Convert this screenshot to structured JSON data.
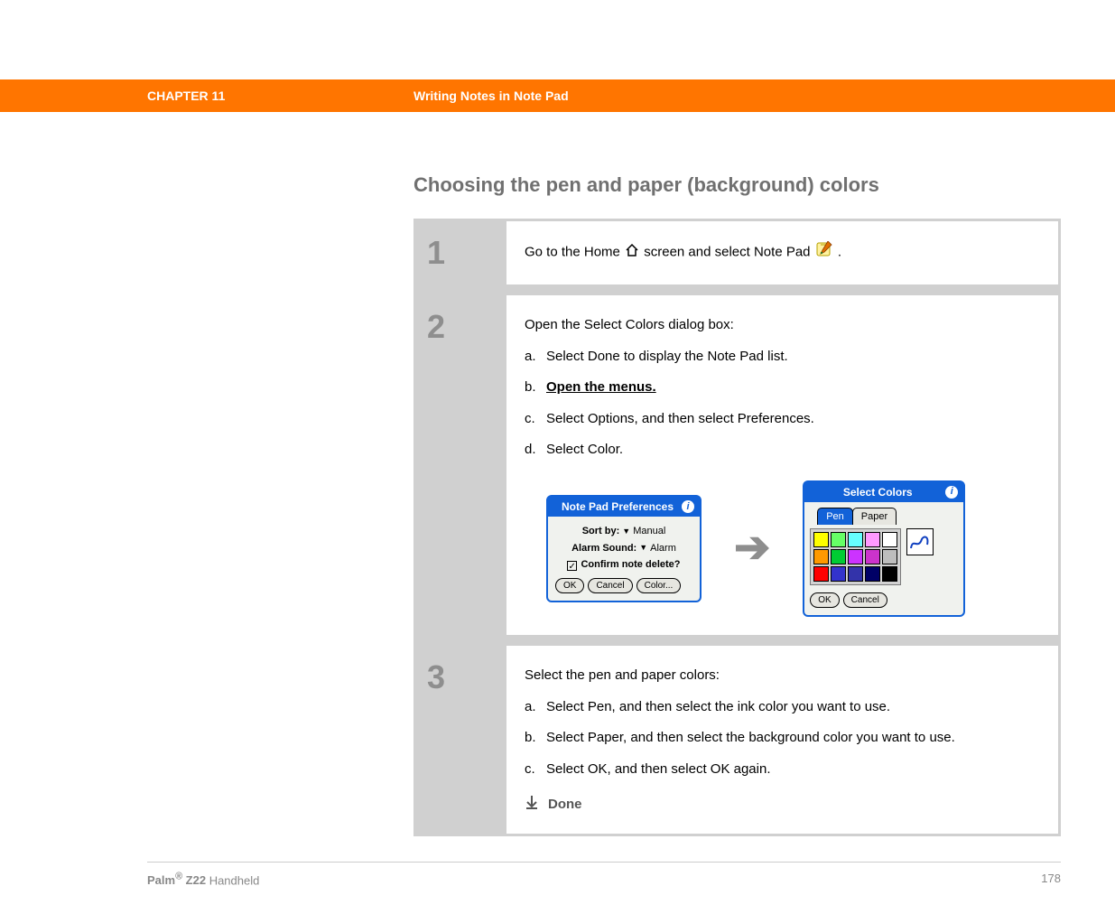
{
  "header": {
    "chapter": "CHAPTER 11",
    "section": "Writing Notes in Note Pad"
  },
  "title": "Choosing the pen and paper (background) colors",
  "steps": {
    "s1": {
      "num": "1",
      "pre": "Go to the Home ",
      "post": " screen and select Note Pad ",
      "end": "."
    },
    "s2": {
      "num": "2",
      "intro": "Open the Select Colors dialog box:",
      "a": {
        "lt": "a.",
        "txt": "Select Done to display the Note Pad list."
      },
      "b": {
        "lt": "b.",
        "txt": "Open the menus."
      },
      "c": {
        "lt": "c.",
        "txt": "Select Options, and then select Preferences."
      },
      "d": {
        "lt": "d.",
        "txt": "Select Color."
      },
      "prefs": {
        "title": "Note Pad Preferences",
        "sortby_label": "Sort by:",
        "sortby_value": "Manual",
        "alarm_label": "Alarm Sound:",
        "alarm_value": "Alarm",
        "confirm_label": "Confirm note delete?",
        "ok": "OK",
        "cancel": "Cancel",
        "color": "Color..."
      },
      "colors_dlg": {
        "title": "Select Colors",
        "tab_pen": "Pen",
        "tab_paper": "Paper",
        "ok": "OK",
        "cancel": "Cancel",
        "palette": [
          [
            "#ffff00",
            "#66ff66",
            "#66ffff",
            "#ff99ff",
            "#ffffff"
          ],
          [
            "#ff9900",
            "#00cc33",
            "#cc33ff",
            "#cc33cc",
            "#bdbdbd"
          ],
          [
            "#ff0000",
            "#3333cc",
            "#3333aa",
            "#000066",
            "#000000"
          ]
        ]
      }
    },
    "s3": {
      "num": "3",
      "intro": "Select the pen and paper colors:",
      "a": {
        "lt": "a.",
        "txt": "Select Pen, and then select the ink color you want to use."
      },
      "b": {
        "lt": "b.",
        "txt": "Select Paper, and then select the background color you want to use."
      },
      "c": {
        "lt": "c.",
        "txt": "Select OK, and then select OK again."
      },
      "done": "Done"
    }
  },
  "footer": {
    "brand_bold": "Palm",
    "brand_sup": "®",
    "brand_model": " Z22",
    "brand_rest": " Handheld",
    "page": "178"
  }
}
